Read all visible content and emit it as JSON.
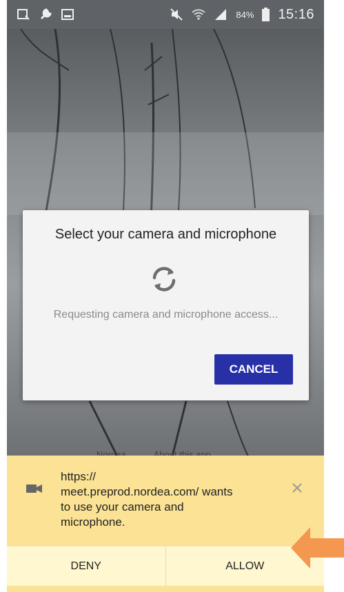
{
  "status_bar": {
    "battery": "84%",
    "time": "15:16"
  },
  "background": {
    "brand_fragment": "Nor",
    "link_nordea": "Nordea",
    "link_about": "About this app"
  },
  "dialog": {
    "title": "Select your camera and microphone",
    "message": "Requesting camera and microphone access...",
    "cancel_label": "CANCEL"
  },
  "permission": {
    "text": "https://\nmeet.preprod.nordea.com/ wants\nto use your camera and\nmicrophone.",
    "deny_label": "DENY",
    "allow_label": "ALLOW"
  },
  "colors": {
    "accent": "#2830a8",
    "banner": "#fbe294",
    "arrow": "#f4974f"
  }
}
